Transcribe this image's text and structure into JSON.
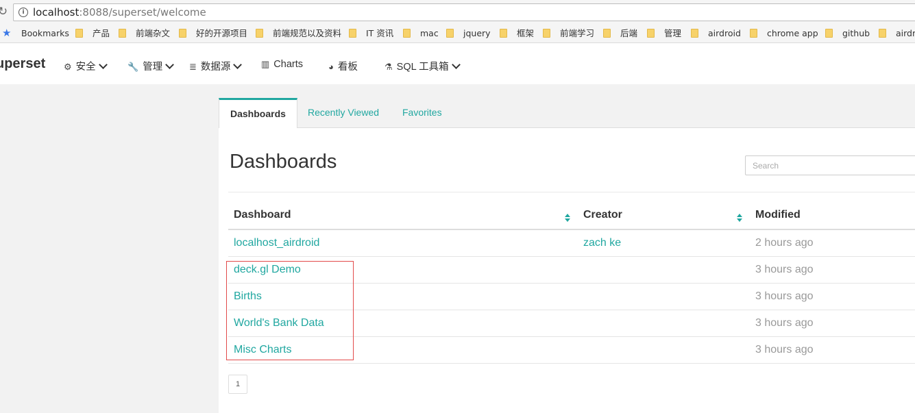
{
  "browser": {
    "url_host": "localhost",
    "url_rest": ":8088/superset/welcome"
  },
  "bookmarks": [
    {
      "label": "Bookmarks",
      "type": "star"
    },
    {
      "label": "产品"
    },
    {
      "label": "前端杂文"
    },
    {
      "label": "好的开源项目"
    },
    {
      "label": "前端规范以及资料"
    },
    {
      "label": "IT 资讯"
    },
    {
      "label": "mac"
    },
    {
      "label": "jquery"
    },
    {
      "label": "框架"
    },
    {
      "label": "前端学习"
    },
    {
      "label": "后端"
    },
    {
      "label": "管理"
    },
    {
      "label": "airdroid"
    },
    {
      "label": "chrome app"
    },
    {
      "label": "github"
    },
    {
      "label": "airdr"
    }
  ],
  "navbar": {
    "brand": "uperset",
    "items": [
      {
        "label": "安全",
        "icon": "cogs-icon",
        "dropdown": true
      },
      {
        "label": "管理",
        "icon": "wrench-icon",
        "dropdown": true
      },
      {
        "label": "数据源",
        "icon": "database-icon",
        "dropdown": true
      },
      {
        "label": "Charts",
        "icon": "bar-chart-icon",
        "dropdown": false
      },
      {
        "label": "看板",
        "icon": "dashboard-icon",
        "dropdown": false
      },
      {
        "label": "SQL 工具箱",
        "icon": "flask-icon",
        "dropdown": true
      }
    ]
  },
  "tabs": [
    {
      "label": "Dashboards",
      "active": true
    },
    {
      "label": "Recently Viewed",
      "active": false
    },
    {
      "label": "Favorites",
      "active": false
    }
  ],
  "main": {
    "title": "Dashboards",
    "search_placeholder": "Search"
  },
  "table": {
    "columns": [
      "Dashboard",
      "Creator",
      "Modified"
    ],
    "rows": [
      {
        "dashboard": "localhost_airdroid",
        "creator": "zach ke",
        "modified": "2 hours ago"
      },
      {
        "dashboard": "deck.gl Demo",
        "creator": "",
        "modified": "3 hours ago"
      },
      {
        "dashboard": "Births",
        "creator": "",
        "modified": "3 hours ago"
      },
      {
        "dashboard": "World's Bank Data",
        "creator": "",
        "modified": "3 hours ago"
      },
      {
        "dashboard": "Misc Charts",
        "creator": "",
        "modified": "3 hours ago"
      }
    ]
  },
  "pagination": {
    "current_page": "1"
  },
  "colors": {
    "accent": "#20a7a0",
    "highlight_box": "#e24a4a"
  }
}
